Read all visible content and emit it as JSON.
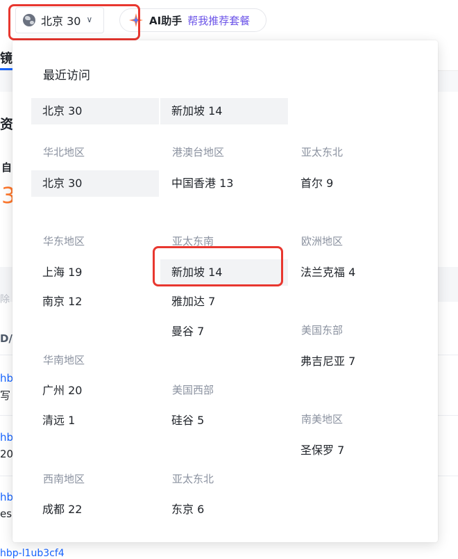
{
  "header": {
    "region_selector": {
      "label": "北京 30"
    },
    "ai_assistant": {
      "title": "AI助手",
      "subtitle": "帮我推荐套餐"
    }
  },
  "background_fragments": {
    "tab": "镜",
    "frag_1": "资",
    "frag_2": "自",
    "frag_3": "3",
    "frag_4": "除",
    "frag_5": "D/",
    "frag_6": "hb",
    "frag_7": "写",
    "frag_8": "hb",
    "frag_9": "20",
    "frag_10": "hb",
    "frag_11": "es",
    "frag_12": "hbp-l1ub3cf4"
  },
  "dropdown": {
    "recent_title": "最近访问",
    "recent_items": [
      {
        "label": "北京 30",
        "selected": true
      },
      {
        "label": "新加坡 14",
        "selected": true
      }
    ],
    "groups": [
      {
        "title": "华北地区",
        "items": [
          {
            "label": "北京 30",
            "selected": true
          }
        ]
      },
      {
        "title": "港澳台地区",
        "items": [
          {
            "label": "中国香港 13"
          }
        ]
      },
      {
        "title": "亚太东北",
        "items": [
          {
            "label": "首尔 9"
          }
        ]
      },
      {
        "title": "华东地区",
        "items": [
          {
            "label": "上海 19"
          },
          {
            "label": "南京 12"
          }
        ]
      },
      {
        "title": "亚太东南",
        "items": [
          {
            "label": "新加坡 14",
            "selected": true
          },
          {
            "label": "雅加达 7"
          },
          {
            "label": "曼谷 7"
          }
        ]
      },
      {
        "title": "欧洲地区",
        "items": [
          {
            "label": "法兰克福 4"
          }
        ]
      },
      {
        "title": "美国东部",
        "items": [
          {
            "label": "弗吉尼亚 7"
          }
        ]
      },
      {
        "title": "华南地区",
        "items": [
          {
            "label": "广州 20"
          },
          {
            "label": "清远 1"
          }
        ]
      },
      {
        "title": "美国西部",
        "items": [
          {
            "label": "硅谷 5"
          }
        ]
      },
      {
        "title": "南美地区",
        "items": [
          {
            "label": "圣保罗 7"
          }
        ]
      },
      {
        "title": "西南地区",
        "items": [
          {
            "label": "成都 22"
          }
        ]
      },
      {
        "title": "亚太东北",
        "items": [
          {
            "label": "东京 6"
          }
        ]
      }
    ]
  }
}
